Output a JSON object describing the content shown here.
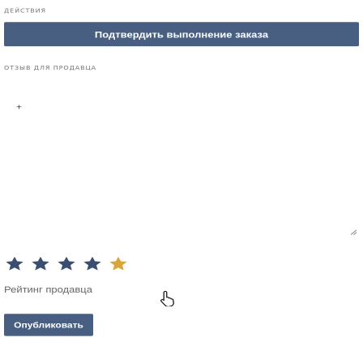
{
  "actions": {
    "label": "действия",
    "confirm_button": "Подтвердить выполнение заказа"
  },
  "feedback": {
    "label": "отзыв для продавца",
    "add_symbol": "+"
  },
  "rating": {
    "label": "Рейтинг продавца",
    "max": 5,
    "value": 4,
    "star_color": "#3a4f70",
    "highlight_color": "#d9a53a",
    "hovered_star": 5
  },
  "publish": {
    "label": "Опубликовать"
  },
  "colors": {
    "primary": "#485f82"
  },
  "icons": {
    "star": "star-icon",
    "resize": "resize-handle-icon",
    "cursor": "hand-pointer-icon"
  }
}
